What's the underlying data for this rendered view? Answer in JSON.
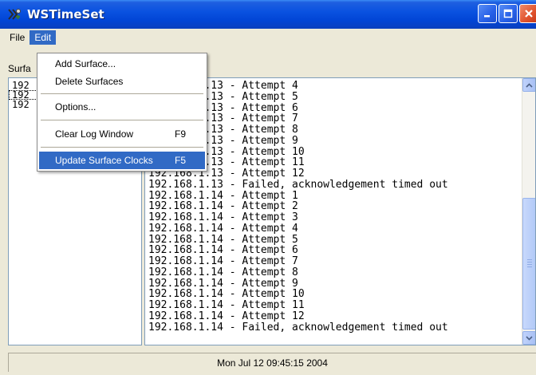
{
  "window": {
    "title": "WSTimeSet",
    "controls": {
      "minimize": "minimize-icon",
      "maximize": "maximize-icon",
      "close": "close-icon"
    }
  },
  "menubar": {
    "file": "File",
    "edit": "Edit"
  },
  "edit_menu": {
    "items": [
      {
        "label": "Add Surface...",
        "shortcut": ""
      },
      {
        "label": "Delete Surfaces",
        "shortcut": ""
      },
      {
        "label": "Options...",
        "shortcut": ""
      },
      {
        "label": "Clear Log Window",
        "shortcut": "F9"
      },
      {
        "label": "Update Surface Clocks",
        "shortcut": "F5"
      }
    ]
  },
  "surfaces": {
    "label": "Surfa",
    "items": [
      "192",
      "192",
      "192"
    ]
  },
  "log": {
    "lines": [
      "192.168.1.13 - Attempt 4",
      "192.168.1.13 - Attempt 5",
      "192.168.1.13 - Attempt 6",
      "192.168.1.13 - Attempt 7",
      "192.168.1.13 - Attempt 8",
      "192.168.1.13 - Attempt 9",
      "192.168.1.13 - Attempt 10",
      "192.168.1.13 - Attempt 11",
      "192.168.1.13 - Attempt 12",
      "192.168.1.13 - Failed, acknowledgement timed out",
      "192.168.1.14 - Attempt 1",
      "192.168.1.14 - Attempt 2",
      "192.168.1.14 - Attempt 3",
      "192.168.1.14 - Attempt 4",
      "192.168.1.14 - Attempt 5",
      "192.168.1.14 - Attempt 6",
      "192.168.1.14 - Attempt 7",
      "192.168.1.14 - Attempt 8",
      "192.168.1.14 - Attempt 9",
      "192.168.1.14 - Attempt 10",
      "192.168.1.14 - Attempt 11",
      "192.168.1.14 - Attempt 12",
      "192.168.1.14 - Failed, acknowledgement timed out"
    ]
  },
  "status": {
    "datetime": "Mon Jul 12 09:45:15 2004"
  },
  "colors": {
    "titlebar": "#0a52e0",
    "menu_highlight": "#316ac5",
    "close_button": "#e0522c"
  }
}
